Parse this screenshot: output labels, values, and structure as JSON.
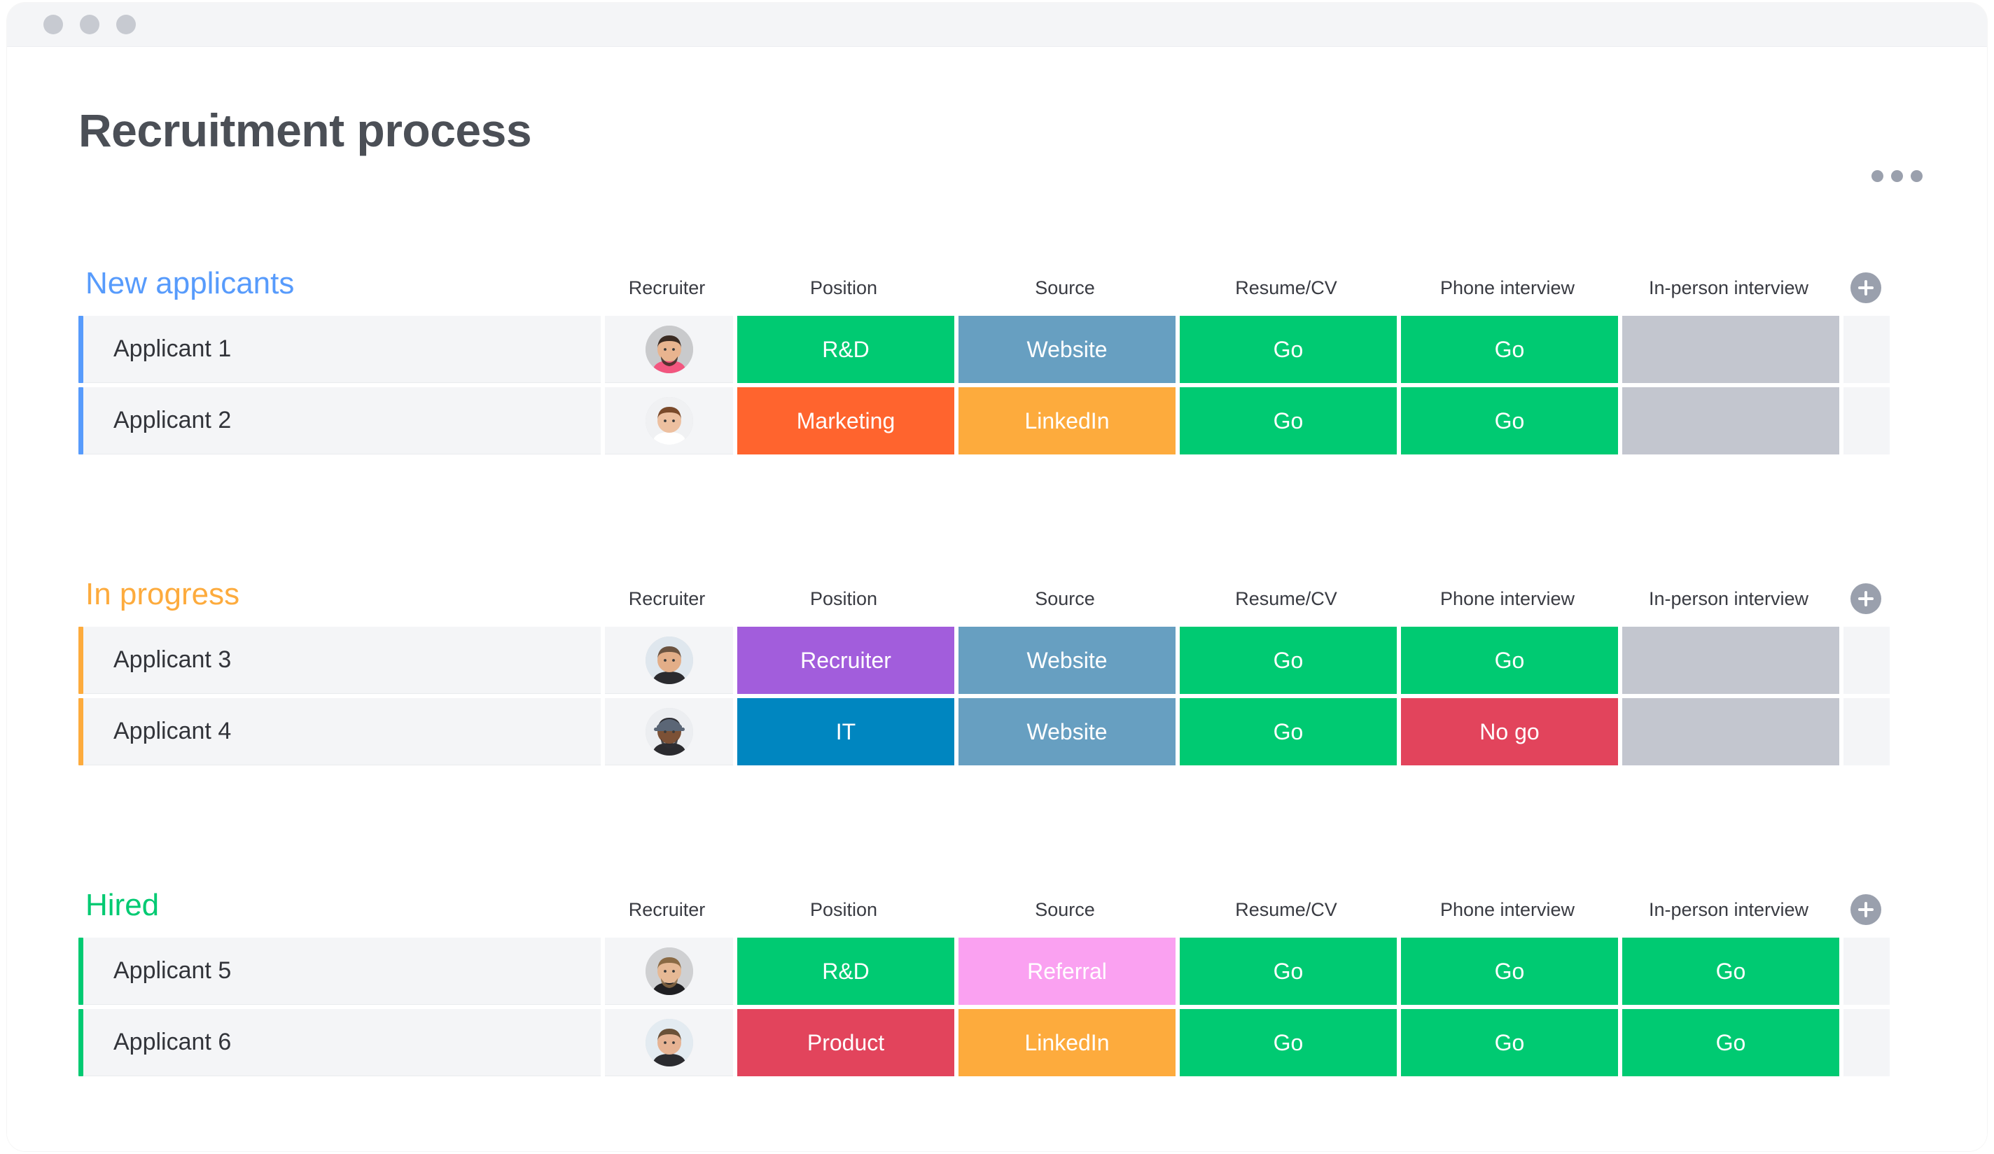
{
  "window": {
    "dots": [
      "window-dot",
      "window-dot",
      "window-dot"
    ]
  },
  "header": {
    "title": "Recruitment process",
    "more_menu_label": "•••"
  },
  "columns": [
    "Recruiter",
    "Position",
    "Source",
    "Resume/CV",
    "Phone interview",
    "In-person interview"
  ],
  "add_column_label": "+",
  "colors": {
    "green": "#00ca72",
    "red": "#e2445c",
    "orange_chip": "#fdab3d",
    "orange_title": "#fdab3d",
    "blue_accent": "#579bfc",
    "blue_it": "#0086c0",
    "purple": "#a25ddc",
    "steel_blue": "#679fc1",
    "tomato": "#ff642e",
    "pink": "#faa1f1",
    "empty_gray": "#c3c6cf",
    "row_bg": "#f4f5f7",
    "title_gray": "#4b4f56"
  },
  "groups": [
    {
      "title": "New applicants",
      "title_color": "#579bfc",
      "accent_color": "#579bfc",
      "rows": [
        {
          "name": "Applicant 1",
          "avatar": "avatar-man-beard-floral",
          "cells": [
            {
              "label": "R&D",
              "color": "#00ca72"
            },
            {
              "label": "Website",
              "color": "#679fc1"
            },
            {
              "label": "Go",
              "color": "#00ca72"
            },
            {
              "label": "Go",
              "color": "#00ca72"
            },
            {
              "label": "",
              "color": "#c3c6cf"
            }
          ]
        },
        {
          "name": "Applicant 2",
          "avatar": "avatar-woman-curly-brown",
          "cells": [
            {
              "label": "Marketing",
              "color": "#ff642e"
            },
            {
              "label": "LinkedIn",
              "color": "#fdab3d"
            },
            {
              "label": "Go",
              "color": "#00ca72"
            },
            {
              "label": "Go",
              "color": "#00ca72"
            },
            {
              "label": "",
              "color": "#c3c6cf"
            }
          ]
        }
      ]
    },
    {
      "title": "In progress",
      "title_color": "#fdab3d",
      "accent_color": "#fdab3d",
      "rows": [
        {
          "name": "Applicant 3",
          "avatar": "avatar-woman-long-blonde",
          "cells": [
            {
              "label": "Recruiter",
              "color": "#a25ddc"
            },
            {
              "label": "Website",
              "color": "#679fc1"
            },
            {
              "label": "Go",
              "color": "#00ca72"
            },
            {
              "label": "Go",
              "color": "#00ca72"
            },
            {
              "label": "",
              "color": "#c3c6cf"
            }
          ]
        },
        {
          "name": "Applicant 4",
          "avatar": "avatar-man-cap-dark",
          "cells": [
            {
              "label": "IT",
              "color": "#0086c0"
            },
            {
              "label": "Website",
              "color": "#679fc1"
            },
            {
              "label": "Go",
              "color": "#00ca72"
            },
            {
              "label": "No go",
              "color": "#e2445c"
            },
            {
              "label": "",
              "color": "#c3c6cf"
            }
          ]
        }
      ]
    },
    {
      "title": "Hired",
      "title_color": "#00ca72",
      "accent_color": "#00ca72",
      "rows": [
        {
          "name": "Applicant 5",
          "avatar": "avatar-man-short-hair",
          "cells": [
            {
              "label": "R&D",
              "color": "#00ca72"
            },
            {
              "label": "Referral",
              "color": "#faa1f1"
            },
            {
              "label": "Go",
              "color": "#00ca72"
            },
            {
              "label": "Go",
              "color": "#00ca72"
            },
            {
              "label": "Go",
              "color": "#00ca72"
            }
          ]
        },
        {
          "name": "Applicant 6",
          "avatar": "avatar-woman-long-blonde-2",
          "cells": [
            {
              "label": "Product",
              "color": "#e2445c"
            },
            {
              "label": "LinkedIn",
              "color": "#fdab3d"
            },
            {
              "label": "Go",
              "color": "#00ca72"
            },
            {
              "label": "Go",
              "color": "#00ca72"
            },
            {
              "label": "Go",
              "color": "#00ca72"
            }
          ]
        }
      ]
    }
  ]
}
